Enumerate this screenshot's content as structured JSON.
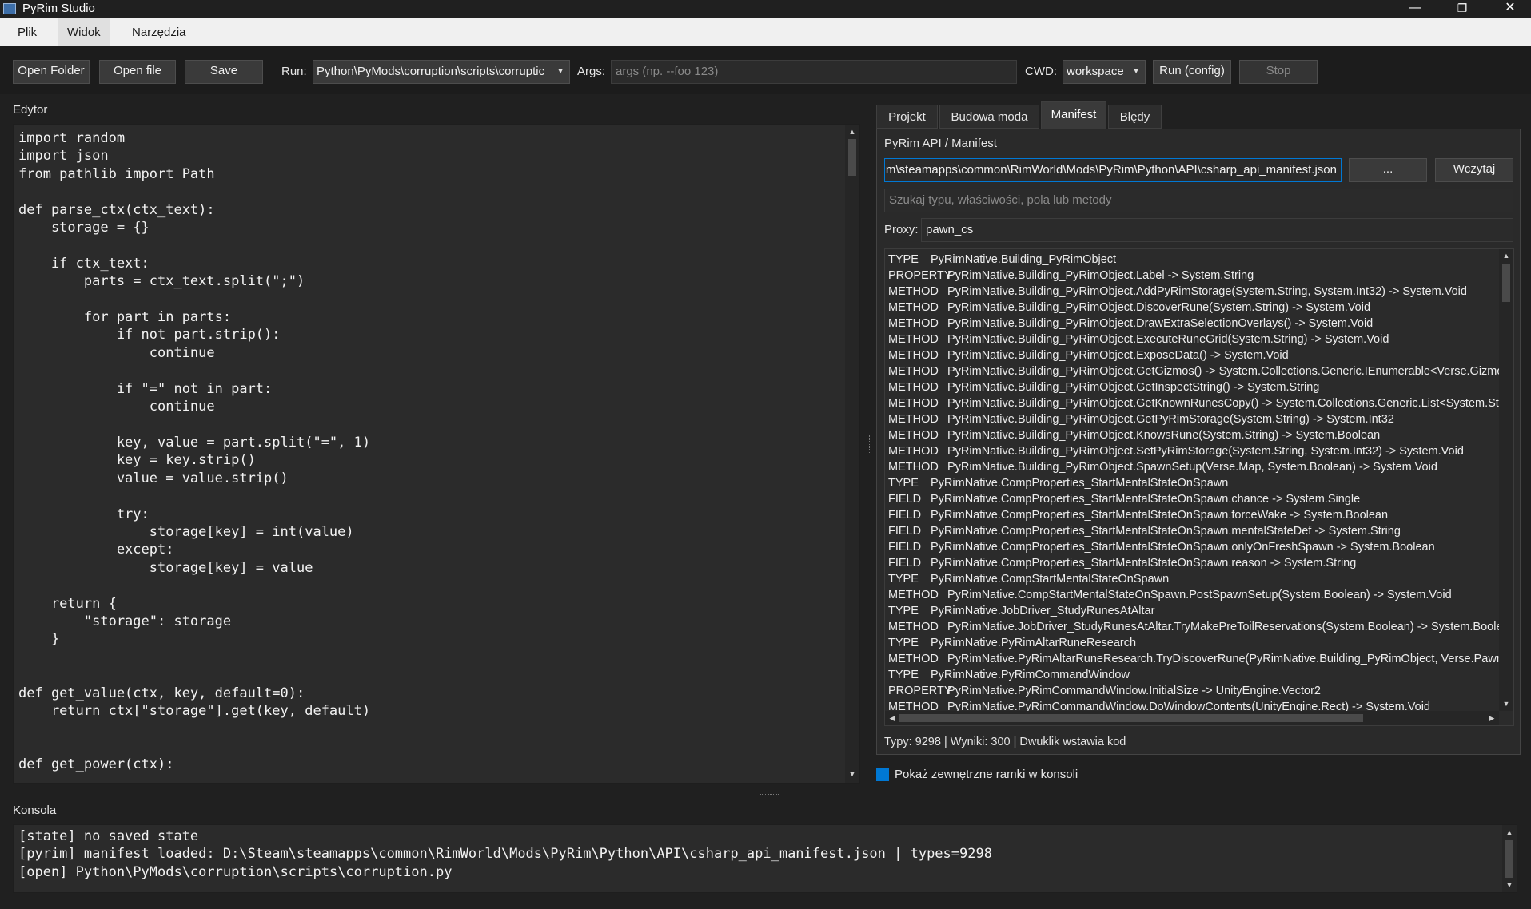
{
  "window": {
    "title": "PyRim Studio",
    "minimize": "—",
    "maximize": "❐",
    "close": "✕"
  },
  "menu": {
    "items": [
      {
        "label": "Plik"
      },
      {
        "label": "Widok"
      },
      {
        "label": "Narzędzia"
      }
    ]
  },
  "toolbar": {
    "open_folder": "Open Folder",
    "open_file": "Open file",
    "save": "Save",
    "run_label": "Run:",
    "run_script": "Python\\PyMods\\corruption\\scripts\\corruptic",
    "args_label": "Args:",
    "args_placeholder": "args (np. --foo 123)",
    "cwd_label": "CWD:",
    "cwd_value": "workspace",
    "run_config": "Run (config)",
    "stop": "Stop"
  },
  "editor": {
    "label": "Edytor",
    "code": "import random\nimport json\nfrom pathlib import Path\n\ndef parse_ctx(ctx_text):\n    storage = {}\n\n    if ctx_text:\n        parts = ctx_text.split(\";\")\n\n        for part in parts:\n            if not part.strip():\n                continue\n\n            if \"=\" not in part:\n                continue\n\n            key, value = part.split(\"=\", 1)\n            key = key.strip()\n            value = value.strip()\n\n            try:\n                storage[key] = int(value)\n            except:\n                storage[key] = value\n\n    return {\n        \"storage\": storage\n    }\n\n\ndef get_value(ctx, key, default=0):\n    return ctx[\"storage\"].get(key, default)\n\n\ndef get_power(ctx):\n    ..."
  },
  "tabs": [
    {
      "label": "Projekt"
    },
    {
      "label": "Budowa moda"
    },
    {
      "label": "Manifest"
    },
    {
      "label": "Błędy"
    }
  ],
  "manifest": {
    "header": "PyRim API / Manifest",
    "path_value": "m\\steamapps\\common\\RimWorld\\Mods\\PyRim\\Python\\API\\csharp_api_manifest.json",
    "browse": "...",
    "load": "Wczytaj",
    "search_placeholder": "Szukaj typu, właściwości, pola lub metody",
    "proxy_label": "Proxy:",
    "proxy_value": "pawn_cs",
    "entries": [
      {
        "kind": "TYPE",
        "text": "PyRimNative.Building_PyRimObject"
      },
      {
        "kind": "PROPERTY",
        "text": "PyRimNative.Building_PyRimObject.Label -> System.String"
      },
      {
        "kind": "METHOD",
        "text": "PyRimNative.Building_PyRimObject.AddPyRimStorage(System.String, System.Int32) -> System.Void"
      },
      {
        "kind": "METHOD",
        "text": "PyRimNative.Building_PyRimObject.DiscoverRune(System.String) -> System.Void"
      },
      {
        "kind": "METHOD",
        "text": "PyRimNative.Building_PyRimObject.DrawExtraSelectionOverlays() -> System.Void"
      },
      {
        "kind": "METHOD",
        "text": "PyRimNative.Building_PyRimObject.ExecuteRuneGrid(System.String) -> System.Void"
      },
      {
        "kind": "METHOD",
        "text": "PyRimNative.Building_PyRimObject.ExposeData() -> System.Void"
      },
      {
        "kind": "METHOD",
        "text": "PyRimNative.Building_PyRimObject.GetGizmos() -> System.Collections.Generic.IEnumerable<Verse.Gizmo>"
      },
      {
        "kind": "METHOD",
        "text": "PyRimNative.Building_PyRimObject.GetInspectString() -> System.String"
      },
      {
        "kind": "METHOD",
        "text": "PyRimNative.Building_PyRimObject.GetKnownRunesCopy() -> System.Collections.Generic.List<System.String>"
      },
      {
        "kind": "METHOD",
        "text": "PyRimNative.Building_PyRimObject.GetPyRimStorage(System.String) -> System.Int32"
      },
      {
        "kind": "METHOD",
        "text": "PyRimNative.Building_PyRimObject.KnowsRune(System.String) -> System.Boolean"
      },
      {
        "kind": "METHOD",
        "text": "PyRimNative.Building_PyRimObject.SetPyRimStorage(System.String, System.Int32) -> System.Void"
      },
      {
        "kind": "METHOD",
        "text": "PyRimNative.Building_PyRimObject.SpawnSetup(Verse.Map, System.Boolean) -> System.Void"
      },
      {
        "kind": "TYPE",
        "text": "PyRimNative.CompProperties_StartMentalStateOnSpawn"
      },
      {
        "kind": "FIELD",
        "text": "PyRimNative.CompProperties_StartMentalStateOnSpawn.chance -> System.Single"
      },
      {
        "kind": "FIELD",
        "text": "PyRimNative.CompProperties_StartMentalStateOnSpawn.forceWake -> System.Boolean"
      },
      {
        "kind": "FIELD",
        "text": "PyRimNative.CompProperties_StartMentalStateOnSpawn.mentalStateDef -> System.String"
      },
      {
        "kind": "FIELD",
        "text": "PyRimNative.CompProperties_StartMentalStateOnSpawn.onlyOnFreshSpawn -> System.Boolean"
      },
      {
        "kind": "FIELD",
        "text": "PyRimNative.CompProperties_StartMentalStateOnSpawn.reason -> System.String"
      },
      {
        "kind": "TYPE",
        "text": "PyRimNative.CompStartMentalStateOnSpawn"
      },
      {
        "kind": "METHOD",
        "text": "PyRimNative.CompStartMentalStateOnSpawn.PostSpawnSetup(System.Boolean) -> System.Void"
      },
      {
        "kind": "TYPE",
        "text": "PyRimNative.JobDriver_StudyRunesAtAltar"
      },
      {
        "kind": "METHOD",
        "text": "PyRimNative.JobDriver_StudyRunesAtAltar.TryMakePreToilReservations(System.Boolean) -> System.Boolean"
      },
      {
        "kind": "TYPE",
        "text": "PyRimNative.PyRimAltarRuneResearch"
      },
      {
        "kind": "METHOD",
        "text": "PyRimNative.PyRimAltarRuneResearch.TryDiscoverRune(PyRimNative.Building_PyRimObject, Verse.Pawn)"
      },
      {
        "kind": "TYPE",
        "text": "PyRimNative.PyRimCommandWindow"
      },
      {
        "kind": "PROPERTY",
        "text": "PyRimNative.PyRimCommandWindow.InitialSize -> UnityEngine.Vector2"
      },
      {
        "kind": "METHOD",
        "text": "PyRimNative.PyRimCommandWindow.DoWindowContents(UnityEngine.Rect) -> System.Void"
      }
    ],
    "status": "Typy: 9298 | Wyniki: 300 | Dwuklik wstawia kod"
  },
  "checkbox": {
    "label": "Pokaż zewnętrzne ramki w konsoli",
    "checked": true
  },
  "console": {
    "label": "Konsola",
    "text": "[state] no saved state\n[pyrim] manifest loaded: D:\\Steam\\steamapps\\common\\RimWorld\\Mods\\PyRim\\Python\\API\\csharp_api_manifest.json | types=9298\n[open] Python\\PyMods\\corruption\\scripts\\corruption.py"
  },
  "icons": {
    "dropdown": "chevron-down-icon",
    "scroll_up": "arrow-up-icon",
    "scroll_down": "arrow-down-icon"
  },
  "colors": {
    "accent": "#0078d4",
    "background": "#202020",
    "panel": "#2b2b2b"
  }
}
